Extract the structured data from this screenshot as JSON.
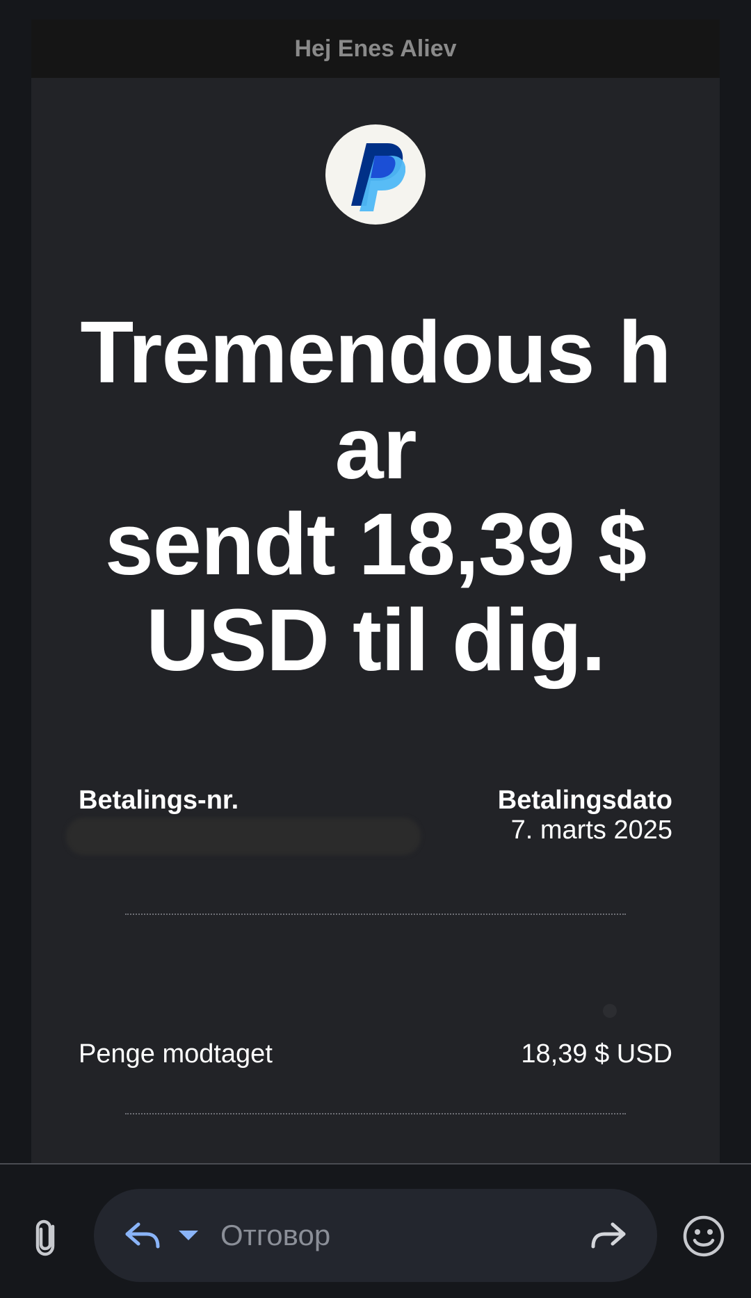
{
  "email": {
    "greeting": "Hej Enes Aliev",
    "logo_icon": "paypal-logo",
    "headline_lines": [
      "Tremendous h",
      "ar",
      "sendt 18,39 $",
      "USD til dig."
    ],
    "payment_number_label": "Betalings-nr.",
    "payment_date_label": "Betalingsdato",
    "payment_date_value": "7. marts 2025",
    "money_received_label": "Penge modtaget",
    "money_received_value": "18,39 $ USD"
  },
  "reply_bar": {
    "attach_icon": "paperclip-icon",
    "reply_icon": "reply-icon",
    "dropdown_icon": "caret-down-icon",
    "placeholder": "Отговор",
    "forward_icon": "forward-icon",
    "emoji_icon": "smiley-icon"
  },
  "colors": {
    "background": "#15171b",
    "card": "#222327",
    "accent": "#8ab4f8",
    "paypal_dark": "#003087",
    "paypal_light": "#4fb8f5"
  }
}
